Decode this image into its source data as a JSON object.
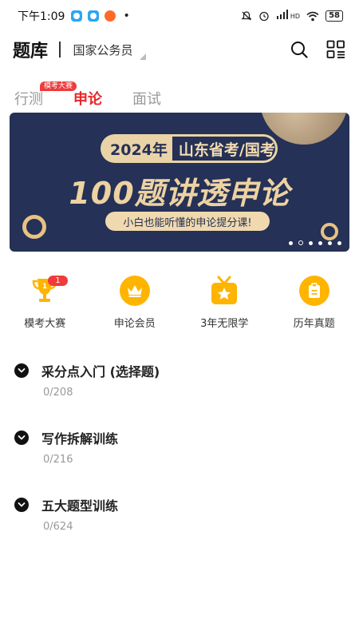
{
  "status_bar": {
    "time": "下午1:09",
    "dot": "•",
    "network": "HD",
    "battery": "58"
  },
  "header": {
    "title": "题库",
    "exam_type": "国家公务员"
  },
  "tabs": [
    {
      "label": "行测",
      "active": false,
      "badge": "模考大赛"
    },
    {
      "label": "申论",
      "active": true
    },
    {
      "label": "面试",
      "active": false
    }
  ],
  "banner": {
    "year": "2024年",
    "region": "山东省考/国考",
    "headline": "100题讲透申论",
    "subtitle": "小白也能听懂的申论提分课!",
    "slides_total": 6,
    "active_slide": 2
  },
  "quick_entries": [
    {
      "label": "模考大赛",
      "icon": "trophy-icon",
      "badge": "1"
    },
    {
      "label": "申论会员",
      "icon": "crown-icon"
    },
    {
      "label": "3年无限学",
      "icon": "tv-star-icon"
    },
    {
      "label": "历年真题",
      "icon": "clipboard-icon"
    }
  ],
  "sections": [
    {
      "title": "采分点入门 (选择题)",
      "progress": "0/208"
    },
    {
      "title": "写作拆解训练",
      "progress": "0/216"
    },
    {
      "title": "五大题型训练",
      "progress": "0/624"
    }
  ],
  "colors": {
    "accent": "#e8262b",
    "banner_bg": "#253156",
    "gold": "#ead3a7",
    "icon_yellow": "#ffb400",
    "badge_red": "#ef3b3b"
  }
}
